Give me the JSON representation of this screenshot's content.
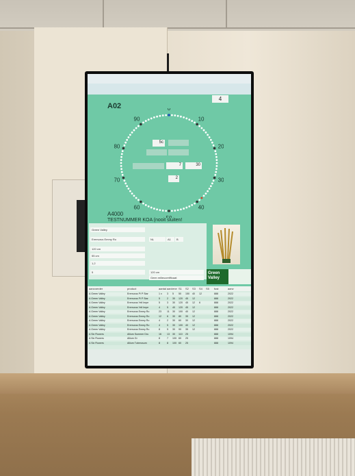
{
  "screen": {
    "bay": "A02",
    "top_number": "4",
    "clock_labels": [
      "0",
      "10",
      "20",
      "30",
      "40",
      "50",
      "60",
      "70",
      "80",
      "90"
    ],
    "fields": {
      "f1": "5c",
      "f2": "7",
      "f3": "30",
      "f4": "2"
    },
    "code": "A4000",
    "test_line": "TESTNUMMER KOA (nooit sluiten!",
    "logo_line1": "Green",
    "logo_line2": "Valley",
    "info": {
      "supplier": "Green Valley",
      "product": "Eremurus Emmy Ro",
      "country": "NL",
      "size_a": "A1",
      "size_b": "B",
      "length1": "120 cm",
      "length2": "55 cm",
      "pack": "1,2",
      "count": "5",
      "length3": "120 cm",
      "env": "Geen milieucertificaat"
    },
    "table_headers": [
      "aanvoerder",
      "product",
      "aantal",
      "aanl",
      "ene",
      "S1",
      "S2",
      "S3",
      "S4",
      "S5",
      "fust",
      "aanv"
    ],
    "rows": [
      {
        "aanvoerder": "A Green Valley",
        "product": "Eremurus Pi P Star",
        "aantal": "1 x",
        "aanl": "3",
        "ene": "5",
        "s1": "50",
        "s2": "150",
        "s3": "40",
        "s4": "12",
        "fust": "888",
        "aanv": "2022"
      },
      {
        "aanvoerder": "A Green Valley",
        "product": "Eremurus Pi P Star",
        "aantal": "5",
        "aanl": "2",
        "ene": "30",
        "s1": "120",
        "s2": "45",
        "s3": "12",
        "s4": "",
        "fust": "888",
        "aanv": "2022"
      },
      {
        "aanvoerder": "A Green Valley",
        "product": "Eremurus Yell Impe",
        "aantal": "5",
        "aanl": "3",
        "ene": "30",
        "s1": "120",
        "s2": "45",
        "s3": "12",
        "s4": "6",
        "fust": "888",
        "aanv": "2022"
      },
      {
        "aanvoerder": "A Green Valley",
        "product": "Eremurus Yell Impe",
        "aantal": "4",
        "aanl": "5",
        "ene": "40",
        "s1": "120",
        "s2": "45",
        "s3": "12",
        "s4": "",
        "fust": "888",
        "aanv": "2022"
      },
      {
        "aanvoerder": "A Green Valley",
        "product": "Eremurus Emmy Ro",
        "aantal": "23",
        "aanl": "11",
        "ene": "30",
        "s1": "100",
        "s2": "40",
        "s3": "12",
        "s4": "",
        "fust": "888",
        "aanv": "2022"
      },
      {
        "aanvoerder": "A Green Valley",
        "product": "Eremurus Emmy Ro",
        "aantal": "12",
        "aanl": "6",
        "ene": "30",
        "s1": "80",
        "s2": "35",
        "s3": "12",
        "s4": "",
        "fust": "888",
        "aanv": "2022"
      },
      {
        "aanvoerder": "A Green Valley",
        "product": "Eremurus Emmy Ro",
        "aantal": "4",
        "aanl": "2",
        "ene": "30",
        "s1": "60",
        "s2": "30",
        "s3": "12",
        "s4": "",
        "fust": "888",
        "aanv": "2022"
      },
      {
        "aanvoerder": "A Green Valley",
        "product": "Eremurus Emmy Ro",
        "aantal": "4",
        "aanl": "5",
        "ene": "30",
        "s1": "100",
        "s2": "40",
        "s3": "12",
        "s4": "",
        "fust": "888",
        "aanv": "2022"
      },
      {
        "aanvoerder": "A Green Valley",
        "product": "Eremurus Emmy Ro",
        "aantal": "8",
        "aanl": "5",
        "ene": "30",
        "s1": "90",
        "s2": "35",
        "s3": "12",
        "s4": "",
        "fust": "888",
        "aanv": "2022"
      },
      {
        "aanvoerder": "A Six Flowers",
        "product": "Allium Summer Dru",
        "aantal": "16",
        "aanl": "13",
        "ene": "30",
        "s1": "110",
        "s2": "25",
        "s3": "",
        "s4": "",
        "fust": "888",
        "aanv": "1094"
      },
      {
        "aanvoerder": "A Six Flowers",
        "product": "Allium Gr",
        "aantal": "8",
        "aanl": "7",
        "ene": "100",
        "s1": "60",
        "s2": "25",
        "s3": "",
        "s4": "",
        "fust": "888",
        "aanv": "1094"
      },
      {
        "aanvoerder": "A Six Flowers",
        "product": "Allium Tuberosum",
        "aantal": "8",
        "aanl": "8",
        "ene": "100",
        "s1": "60",
        "s2": "25",
        "s3": "",
        "s4": "",
        "fust": "888",
        "aanv": "1094"
      }
    ]
  }
}
